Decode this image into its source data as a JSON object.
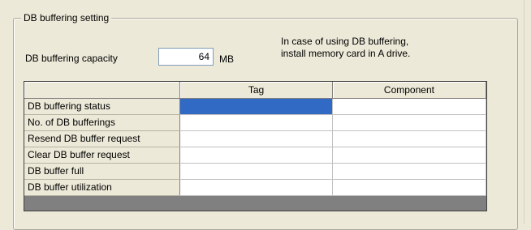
{
  "group": {
    "title": "DB buffering setting"
  },
  "capacity": {
    "label": "DB buffering capacity",
    "value": "64",
    "unit": "MB"
  },
  "note": {
    "line1": "In case of using DB buffering,",
    "line2": "install memory card in A drive."
  },
  "grid": {
    "columns": [
      "",
      "Tag",
      "Component"
    ],
    "rows": [
      {
        "label": "DB buffering status",
        "tag": "",
        "component": ""
      },
      {
        "label": "No. of DB bufferings",
        "tag": "",
        "component": ""
      },
      {
        "label": "Resend DB buffer request",
        "tag": "",
        "component": ""
      },
      {
        "label": "Clear DB buffer request",
        "tag": "",
        "component": ""
      },
      {
        "label": "DB buffer full",
        "tag": "",
        "component": ""
      },
      {
        "label": "DB buffer utilization",
        "tag": "",
        "component": ""
      }
    ],
    "selected_cell": {
      "row": 0,
      "column": "Tag"
    },
    "selection_color": "#316AC5"
  }
}
